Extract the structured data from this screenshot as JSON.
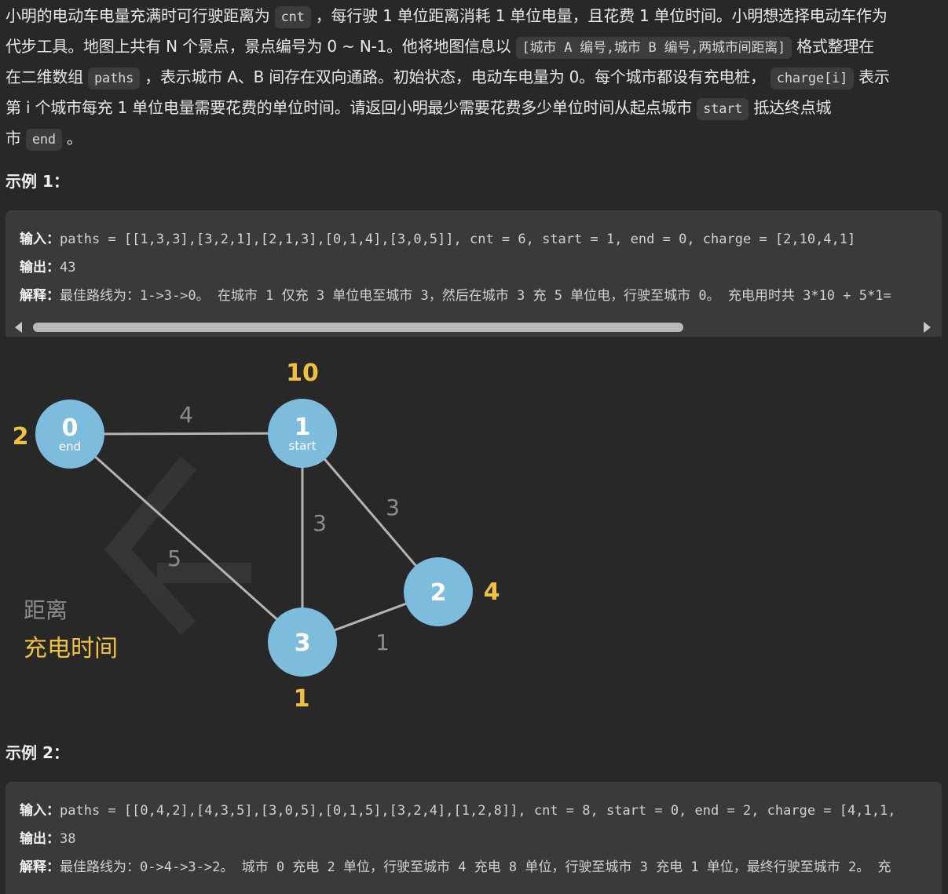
{
  "description": {
    "line1_a": "小明的电动车电量充满时可行驶距离为",
    "cnt_code": "cnt",
    "line1_b": "，每行驶 1 单位距离消耗 1 单位电量，且花费 1 单位时间。小明想选择电动车作为",
    "line2_a": "代步工具。地图上共有 N 个景点，景点编号为 0 ~ N-1。他将地图信息以",
    "format_code": "[城市 A 编号,城市 B 编号,两城市间距离]",
    "line2_b": "格式整理在",
    "line3_a": "在二维数组",
    "paths_code": "paths",
    "line3_b": "，表示城市 A、B 间存在双向通路。初始状态，电动车电量为 0。每个城市都设有充电桩，",
    "charge_code": "charge[i]",
    "line3_c": "表示",
    "line4_a": "第 i 个城市每充 1 单位电量需要花费的单位时间。请返回小明最少需要花费多少单位时间从起点城市",
    "start_code": "start",
    "line4_b": "抵达终点城",
    "line5_a": "市",
    "end_code": "end",
    "line5_b": "。"
  },
  "example1": {
    "title": "示例 1：",
    "input_label": "输入：",
    "input_value": "paths = [[1,3,3],[3,2,1],[2,1,3],[0,1,4],[3,0,5]], cnt = 6, start = 1, end = 0, charge = [2,10,4,1]",
    "output_label": "输出：",
    "output_value": "43",
    "explain_label": "解释：",
    "explain_value": "最佳路线为：1->3->0。 在城市 1 仅充 3 单位电至城市 3，然后在城市 3 充 5 单位电，行驶至城市 0。 充电用时共 3*10 + 5*1="
  },
  "graph": {
    "nodes": [
      {
        "id": "0",
        "sub": "end",
        "charge": "2"
      },
      {
        "id": "1",
        "sub": "start",
        "charge": "10"
      },
      {
        "id": "2",
        "sub": "",
        "charge": "4"
      },
      {
        "id": "3",
        "sub": "",
        "charge": "1"
      }
    ],
    "edges": [
      {
        "from": "0",
        "to": "1",
        "weight": "4"
      },
      {
        "from": "1",
        "to": "3",
        "weight": "3"
      },
      {
        "from": "1",
        "to": "2",
        "weight": "3"
      },
      {
        "from": "0",
        "to": "3",
        "weight": "5"
      },
      {
        "from": "3",
        "to": "2",
        "weight": "1"
      }
    ],
    "legend_distance": "距离",
    "legend_charge": "充电时间",
    "colors": {
      "node": "#7dbcdd",
      "charge": "#f0c040",
      "edge": "#b4b4b4",
      "weight": "#8c8c8c"
    }
  },
  "example2": {
    "title": "示例 2：",
    "input_label": "输入：",
    "input_value": "paths = [[0,4,2],[4,3,5],[3,0,5],[0,1,5],[3,2,4],[1,2,8]], cnt = 8, start = 0, end = 2, charge = [4,1,1,",
    "output_label": "输出：",
    "output_value": "38",
    "explain_label": "解释：",
    "explain_value": "最佳路线为：0->4->3->2。 城市 0 充电 2 单位，行驶至城市 4 充电 8 单位，行驶至城市 3 充电 1 单位，最终行驶至城市 2。 充"
  }
}
